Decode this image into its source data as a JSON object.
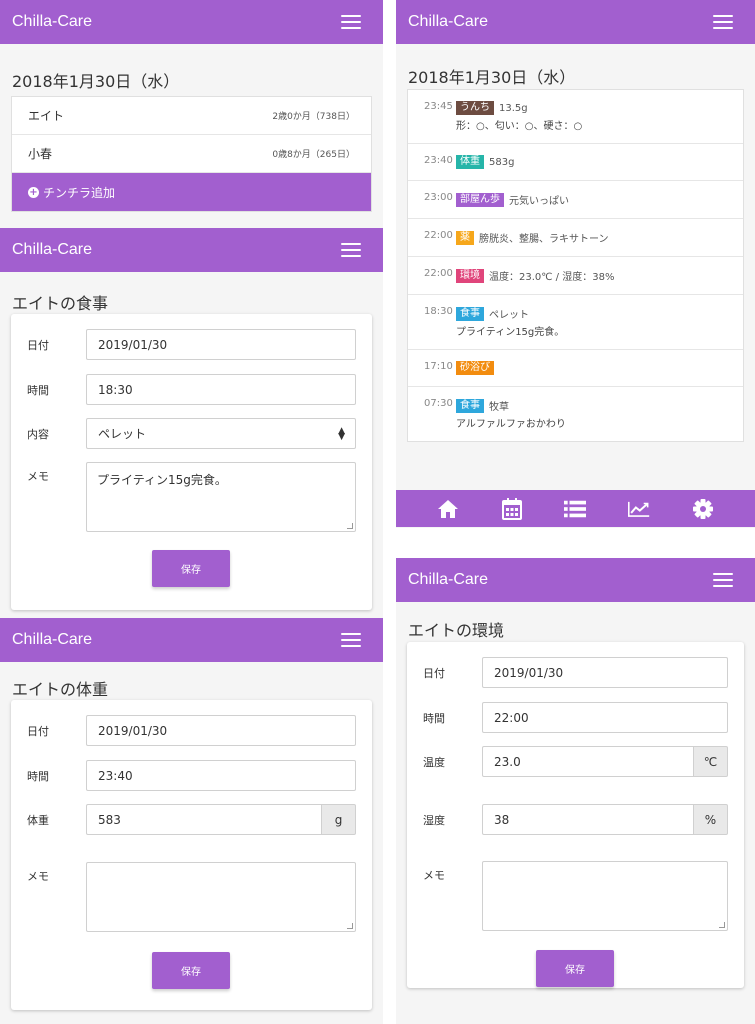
{
  "app_title": "Chilla-Care",
  "list_screen": {
    "date": "2018年1月30日（水）",
    "pets": [
      {
        "name": "エイト",
        "age": "2歳0か月（738日）"
      },
      {
        "name": "小春",
        "age": "0歳8か月（265日）"
      }
    ],
    "add_label": "チンチラ追加"
  },
  "meal_screen": {
    "title": "エイトの食事",
    "date_label": "日付",
    "date_value": "2019/01/30",
    "time_label": "時間",
    "time_value": "18:30",
    "content_label": "内容",
    "content_value": "ペレット",
    "memo_label": "メモ",
    "memo_value": "プライティン15g完食。",
    "save_label": "保存"
  },
  "weight_screen": {
    "title": "エイトの体重",
    "date_label": "日付",
    "date_value": "2019/01/30",
    "time_label": "時間",
    "time_value": "23:40",
    "weight_label": "体重",
    "weight_value": "583",
    "weight_unit": "g",
    "memo_label": "メモ",
    "memo_value": "",
    "save_label": "保存"
  },
  "timeline_screen": {
    "date": "2018年1月30日（水）",
    "entries": [
      {
        "time": "23:45",
        "tag": "うんち",
        "tag_color": "#6d4c41",
        "value": "13.5g",
        "note": "形：○、匂い：○、硬さ：○"
      },
      {
        "time": "23:40",
        "tag": "体重",
        "tag_color": "#26b5a9",
        "value": "583g",
        "note": ""
      },
      {
        "time": "23:00",
        "tag": "部屋ん歩",
        "tag_color": "#a25fcf",
        "value": "元気いっぱい",
        "note": ""
      },
      {
        "time": "22:00",
        "tag": "薬",
        "tag_color": "#f6a71b",
        "value": "膀胱炎、整腸、ラキサトーン",
        "note": ""
      },
      {
        "time": "22:00",
        "tag": "環境",
        "tag_color": "#e0457b",
        "value": "温度：23.0℃ / 湿度：38%",
        "note": ""
      },
      {
        "time": "18:30",
        "tag": "食事",
        "tag_color": "#2ea7dc",
        "value": "ペレット",
        "note": "プライティン15g完食。"
      },
      {
        "time": "17:10",
        "tag": "砂浴び",
        "tag_color": "#f28c0f",
        "value": "",
        "note": ""
      },
      {
        "time": "07:30",
        "tag": "食事",
        "tag_color": "#2ea7dc",
        "value": "牧草",
        "note": "アルファルファおかわり"
      }
    ],
    "nav": [
      "home-icon",
      "calendar-icon",
      "list-icon",
      "chart-icon",
      "gear-icon"
    ]
  },
  "env_screen": {
    "title": "エイトの環境",
    "date_label": "日付",
    "date_value": "2019/01/30",
    "time_label": "時間",
    "time_value": "22:00",
    "temp_label": "温度",
    "temp_value": "23.0",
    "temp_unit": "℃",
    "humidity_label": "湿度",
    "humidity_value": "38",
    "humidity_unit": "%",
    "memo_label": "メモ",
    "memo_value": "",
    "save_label": "保存"
  },
  "colors": {
    "brand": "#a25fcf"
  }
}
